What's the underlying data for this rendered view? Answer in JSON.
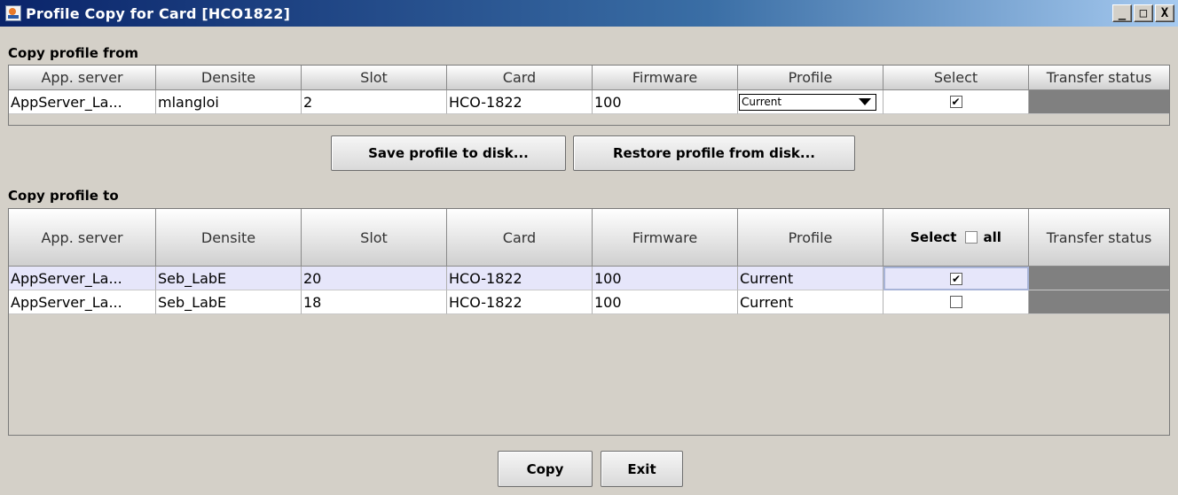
{
  "window": {
    "title": "Profile Copy for Card [HCO1822]",
    "controls": {
      "minimize": "_",
      "maximize": "□",
      "close": "X"
    }
  },
  "from_section": {
    "label": "Copy profile from",
    "columns": [
      "App. server",
      "Densite",
      "Slot",
      "Card",
      "Firmware",
      "Profile",
      "Select",
      "Transfer status"
    ],
    "rows": [
      {
        "app_server": "AppServer_La...",
        "densite": "mlangloi",
        "slot": "2",
        "card": "HCO-1822",
        "firmware": "100",
        "profile": "Current",
        "selected": true,
        "transfer_status": ""
      }
    ]
  },
  "disk_buttons": {
    "save": "Save profile to disk...",
    "restore": "Restore profile from disk..."
  },
  "to_section": {
    "label": "Copy profile to",
    "columns": [
      "App. server",
      "Densite",
      "Slot",
      "Card",
      "Firmware",
      "Profile",
      "Select",
      "Transfer status"
    ],
    "select_all_label": "all",
    "select_all_checked": false,
    "rows": [
      {
        "app_server": "AppServer_La...",
        "densite": "Seb_LabE",
        "slot": "20",
        "card": "HCO-1822",
        "firmware": "100",
        "profile": "Current",
        "selected": true,
        "transfer_status": ""
      },
      {
        "app_server": "AppServer_La...",
        "densite": "Seb_LabE",
        "slot": "18",
        "card": "HCO-1822",
        "firmware": "100",
        "profile": "Current",
        "selected": false,
        "transfer_status": ""
      }
    ]
  },
  "footer": {
    "copy": "Copy",
    "exit": "Exit"
  },
  "colors": {
    "window_bg": "#d4d0c8",
    "title_bar": "#0a246a",
    "selected_row": "#e6e6fa",
    "status_cell": "#808080"
  }
}
